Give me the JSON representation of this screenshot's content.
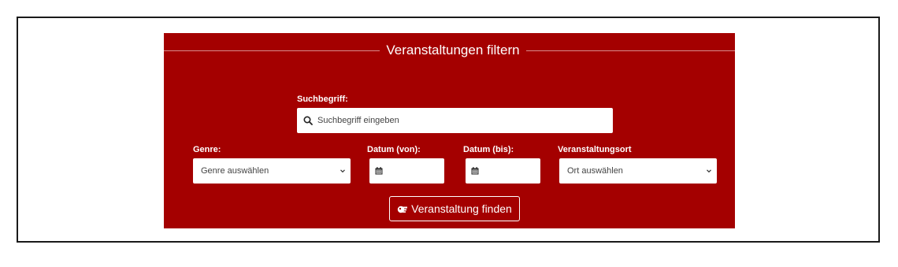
{
  "legend": "Veranstaltungen filtern",
  "search": {
    "label": "Suchbegriff:",
    "placeholder": "Suchbegriff eingeben"
  },
  "genre": {
    "label": "Genre:",
    "selected": "Genre auswählen"
  },
  "date_from": {
    "label": "Datum (von):"
  },
  "date_to": {
    "label": "Datum (bis):"
  },
  "venue": {
    "label": "Veranstaltungsort",
    "selected": "Ort auswählen"
  },
  "submit": {
    "label": "Veranstaltung finden"
  },
  "colors": {
    "panel": "#a40000",
    "text": "#ffffff",
    "frame": "#1a1a1a"
  },
  "icons": {
    "search": "search-icon",
    "calendar": "calendar-icon",
    "chevron": "chevron-down-icon",
    "button": "hand-pointer-icon"
  }
}
